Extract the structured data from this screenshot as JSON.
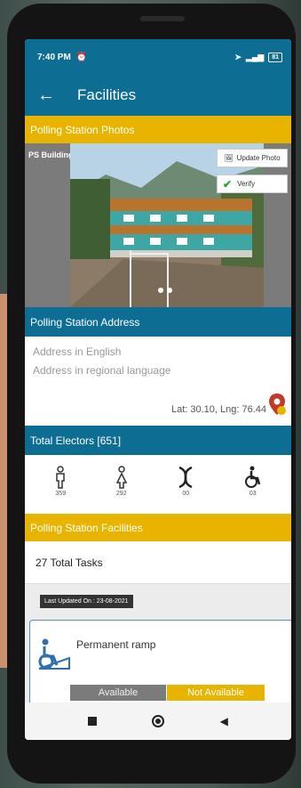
{
  "status": {
    "time": "7:40 PM",
    "battery": "81"
  },
  "appbar": {
    "title": "Facilities"
  },
  "photos": {
    "header": "Polling Station Photos",
    "image_label": "PS Building",
    "update_label": "Update Photo",
    "verify_label": "Verify",
    "carousel_count": 2
  },
  "address": {
    "header": "Polling Station Address",
    "english_placeholder": "Address in English",
    "regional_placeholder": "Address in regional language",
    "latlng": "Lat: 30.10, Lng: 76.44"
  },
  "electors": {
    "header": "Total Electors [651]",
    "male": "359",
    "female": "292",
    "transgender": "00",
    "pwd": "03"
  },
  "facilities": {
    "header": "Polling Station Facilities",
    "tasks": "27 Total Tasks",
    "last_updated": "Last Updated On : 23-08-2021"
  },
  "card": {
    "name": "Permanent ramp",
    "available": "Available",
    "not_available": "Not Available"
  },
  "colors": {
    "primary": "#0e6d93",
    "accent": "#e8b400",
    "pin": "#c0392b"
  }
}
